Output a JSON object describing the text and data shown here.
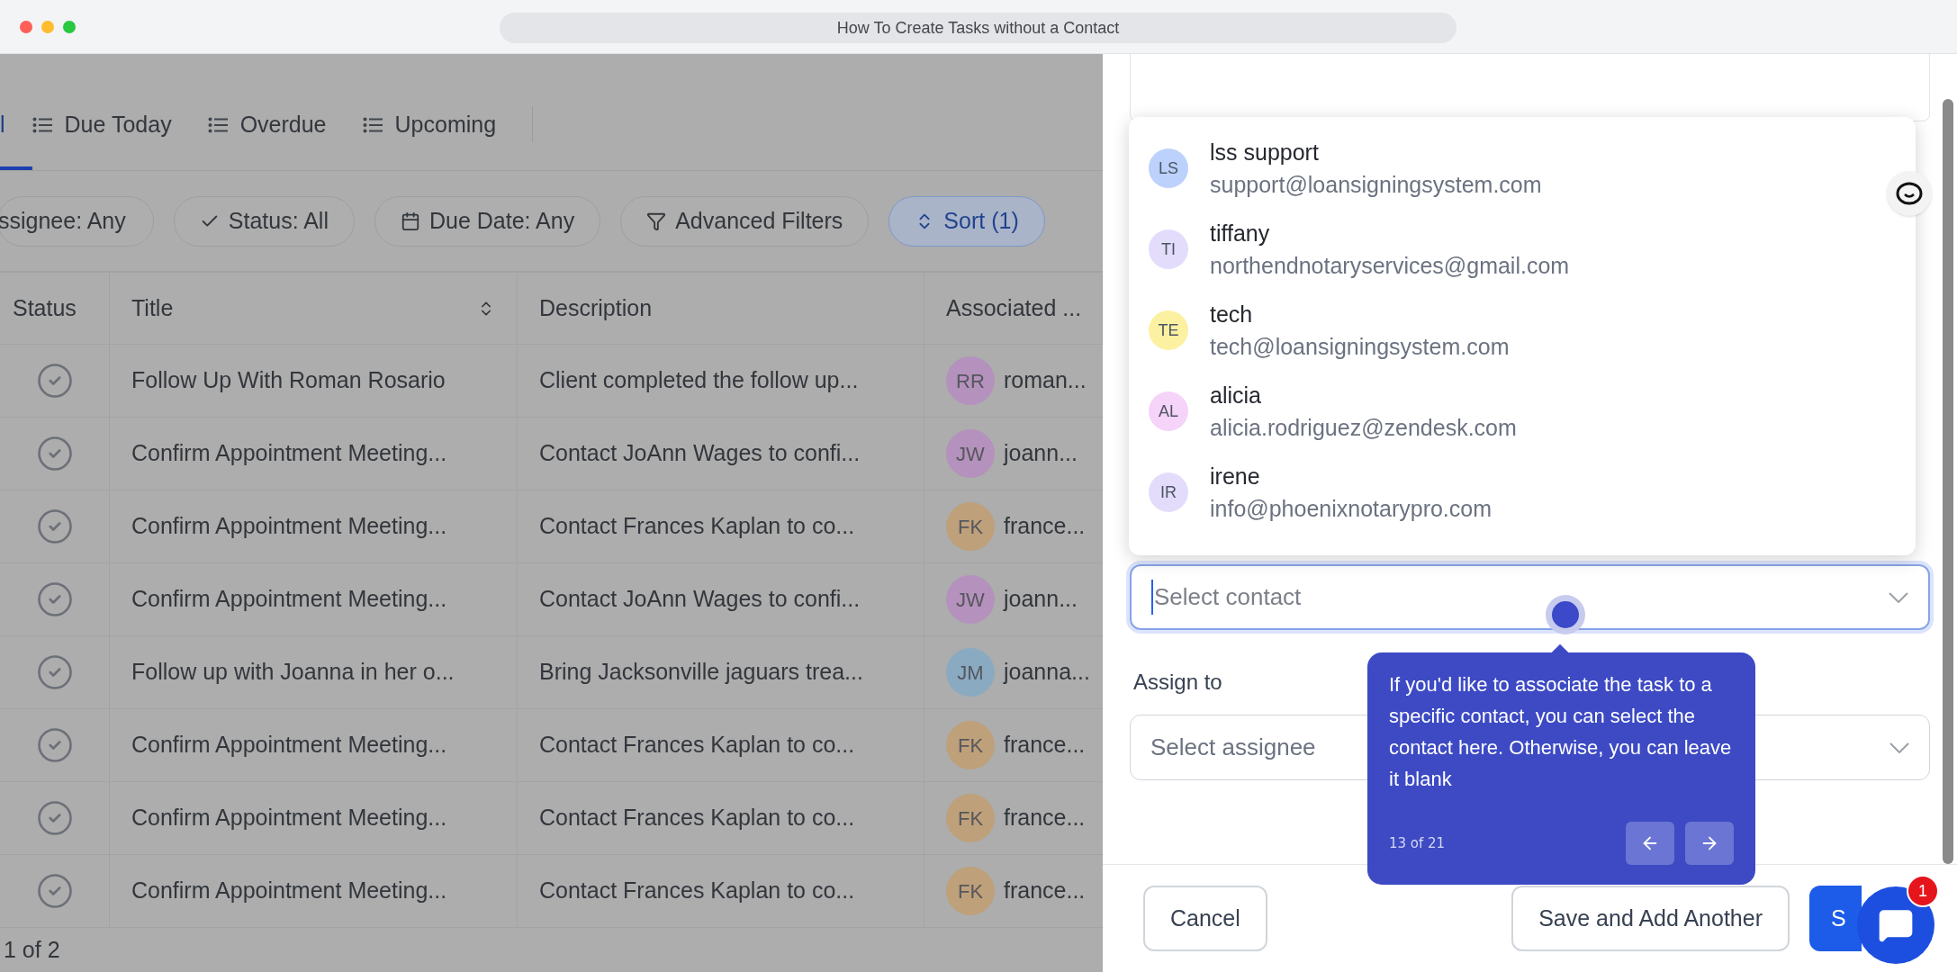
{
  "window": {
    "title": "How To Create Tasks without a Contact"
  },
  "tabs": [
    {
      "label": "l",
      "selected": true
    },
    {
      "label": "Due Today",
      "selected": false
    },
    {
      "label": "Overdue",
      "selected": false
    },
    {
      "label": "Upcoming",
      "selected": false
    }
  ],
  "filters": [
    {
      "label": "ssignee: Any",
      "kind": "plain",
      "active": false
    },
    {
      "label": "Status: All",
      "kind": "check",
      "active": false
    },
    {
      "label": "Due Date: Any",
      "kind": "calendar",
      "active": false
    },
    {
      "label": "Advanced Filters",
      "kind": "filter",
      "active": false
    },
    {
      "label": "Sort (1)",
      "kind": "sort",
      "active": true
    }
  ],
  "table": {
    "columns": [
      "Status",
      "Title",
      "Description",
      "Associated ..."
    ],
    "rows": [
      {
        "title": "Follow Up With Roman Rosario",
        "description": "Client completed the follow up...",
        "initials": "RR",
        "contact": "roman...",
        "color": "#b591bd"
      },
      {
        "title": "Confirm Appointment Meeting...",
        "description": "Contact JoAnn Wages to confi...",
        "initials": "JW",
        "contact": "joann...",
        "color": "#b591bd"
      },
      {
        "title": "Confirm Appointment Meeting...",
        "description": "Contact Frances Kaplan to co...",
        "initials": "FK",
        "contact": "france...",
        "color": "#bea07a"
      },
      {
        "title": "Confirm Appointment Meeting...",
        "description": "Contact JoAnn Wages to confi...",
        "initials": "JW",
        "contact": "joann...",
        "color": "#b591bd"
      },
      {
        "title": "Follow up with Joanna in her o...",
        "description": "Bring Jacksonville jaguars trea...",
        "initials": "JM",
        "contact": "joanna...",
        "color": "#8aaac2"
      },
      {
        "title": "Confirm Appointment Meeting...",
        "description": "Contact Frances Kaplan to co...",
        "initials": "FK",
        "contact": "france...",
        "color": "#bea07a"
      },
      {
        "title": "Confirm Appointment Meeting...",
        "description": "Contact Frances Kaplan to co...",
        "initials": "FK",
        "contact": "france...",
        "color": "#bea07a"
      },
      {
        "title": "Confirm Appointment Meeting...",
        "description": "Contact Frances Kaplan to co...",
        "initials": "FK",
        "contact": "france...",
        "color": "#bea07a"
      }
    ],
    "pagination": "1 of 2"
  },
  "contact_options": [
    {
      "initials": "LS",
      "name": "lss support",
      "email": "support@loansigningsystem.com",
      "color": "#bcd1fb"
    },
    {
      "initials": "TI",
      "name": "tiffany",
      "email": "northendnotaryservices@gmail.com",
      "color": "#e4dcfb"
    },
    {
      "initials": "TE",
      "name": "tech",
      "email": "tech@loansigningsystem.com",
      "color": "#fbf1a1"
    },
    {
      "initials": "AL",
      "name": "alicia",
      "email": "alicia.rodriguez@zendesk.com",
      "color": "#f6d3f9"
    },
    {
      "initials": "IR",
      "name": "irene",
      "email": "info@phoenixnotarypro.com",
      "color": "#e4dcfb"
    }
  ],
  "contact_field": {
    "placeholder": "Select contact"
  },
  "assign": {
    "label": "Assign to",
    "placeholder": "Select assignee"
  },
  "tooltip": {
    "text": "If you'd like to associate the task to a specific contact, you can select the contact here. Otherwise, you can leave it blank",
    "step": "13 of 21"
  },
  "buttons": [
    {
      "label": "Cancel",
      "kind": "secondary"
    },
    {
      "label": "Save and Add Another",
      "kind": "secondary"
    },
    {
      "label": "S",
      "kind": "primary"
    }
  ],
  "chat": {
    "badge": "1"
  }
}
